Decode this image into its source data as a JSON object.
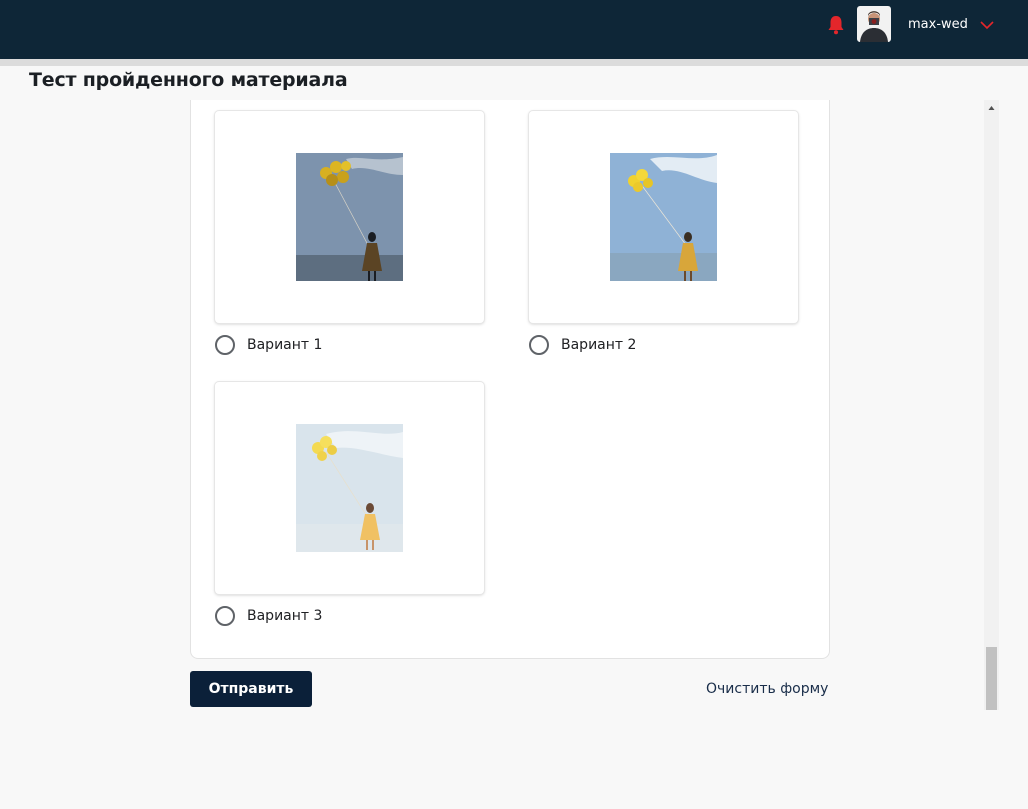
{
  "header": {
    "username": "max-wed",
    "icons": {
      "notification": "bell-icon",
      "menu": "chevron-down-icon"
    },
    "colors": {
      "background": "#0e2637",
      "accent": "#e4262b"
    }
  },
  "page": {
    "title": "Тест пройденного материала"
  },
  "question": {
    "options": [
      {
        "label": "Вариант 1",
        "selected": false
      },
      {
        "label": "Вариант 2",
        "selected": false
      },
      {
        "label": "Вариант 3",
        "selected": false
      }
    ]
  },
  "actions": {
    "submit_label": "Отправить",
    "clear_label": "Очистить форму"
  }
}
